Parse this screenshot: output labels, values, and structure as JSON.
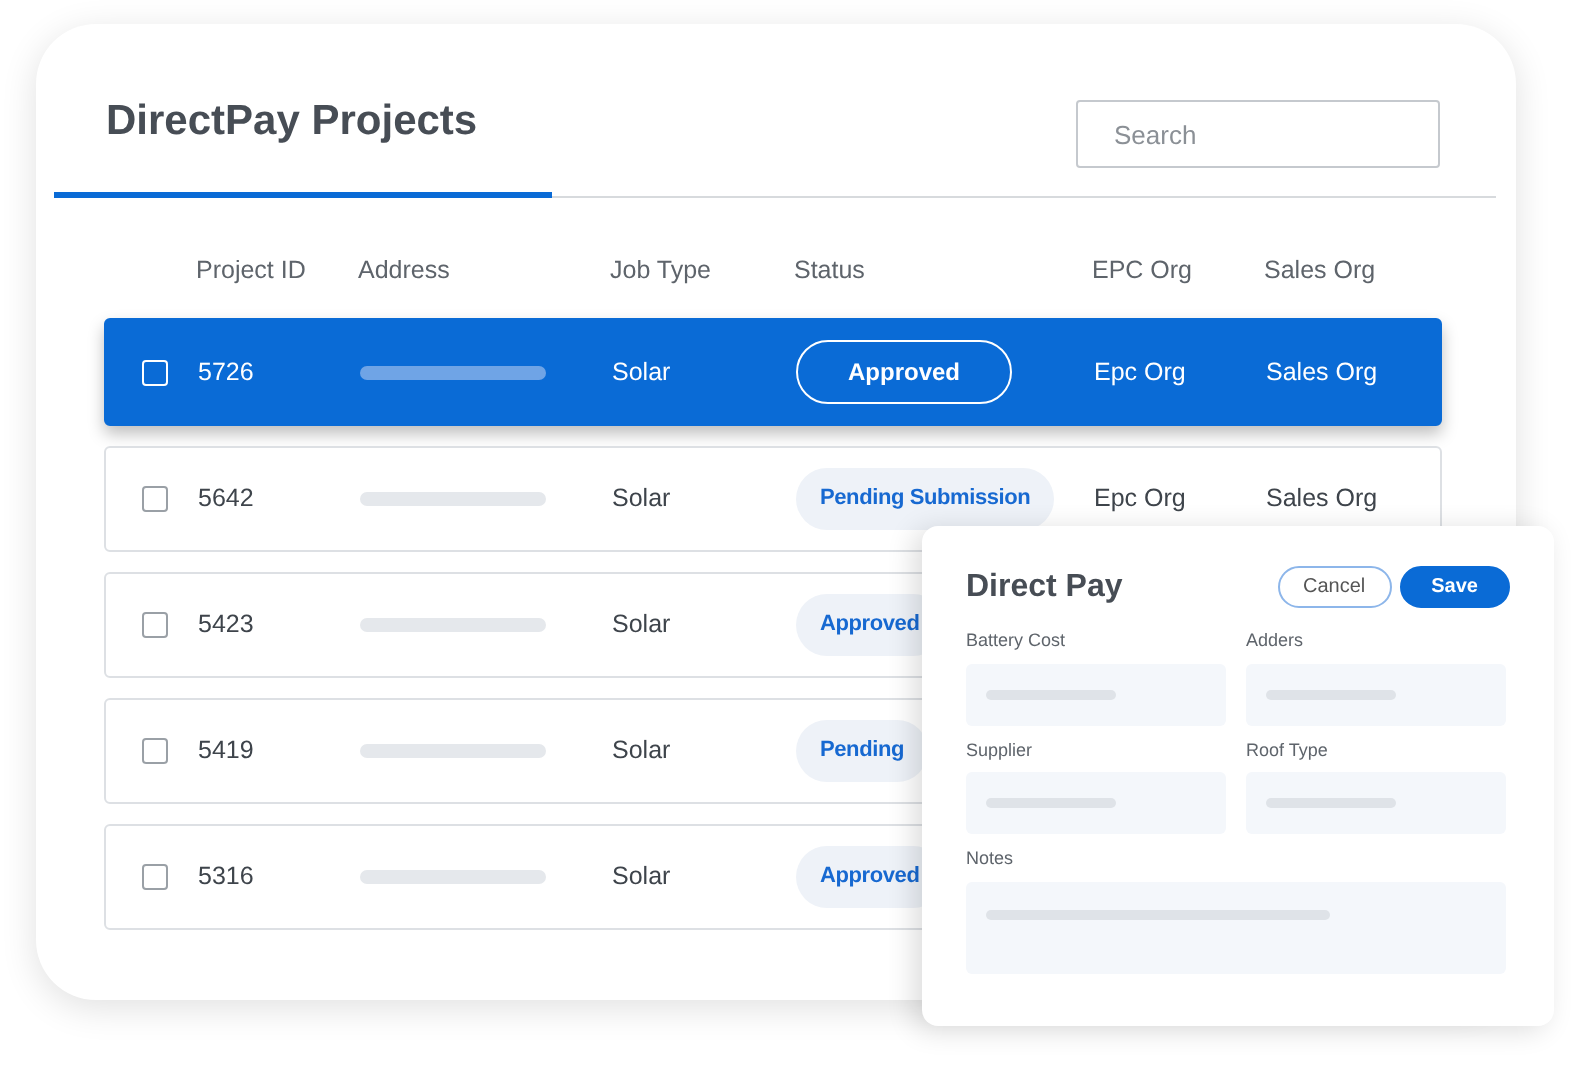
{
  "title": "DirectPay Projects",
  "search": {
    "placeholder": "Search"
  },
  "table": {
    "columns": [
      "Project ID",
      "Address",
      "Job Type",
      "Status",
      "EPC Org",
      "Sales Org"
    ],
    "rows": [
      {
        "selected": true,
        "checked": false,
        "project_id": "5726",
        "job_type": "Solar",
        "status": "Approved",
        "epc_org": "Epc Org",
        "sales_org": "Sales Org"
      },
      {
        "selected": false,
        "checked": false,
        "project_id": "5642",
        "job_type": "Solar",
        "status": "Pending Submission",
        "epc_org": "Epc Org",
        "sales_org": "Sales Org"
      },
      {
        "selected": false,
        "checked": false,
        "project_id": "5423",
        "job_type": "Solar",
        "status": "Approved"
      },
      {
        "selected": false,
        "checked": false,
        "project_id": "5419",
        "job_type": "Solar",
        "status": "Pending"
      },
      {
        "selected": false,
        "checked": false,
        "project_id": "5316",
        "job_type": "Solar",
        "status": "Approved"
      }
    ]
  },
  "panel": {
    "title": "Direct Pay",
    "buttons": [
      {
        "label": "Cancel",
        "kind": "secondary"
      },
      {
        "label": "Save",
        "kind": "primary"
      }
    ],
    "fields": [
      {
        "label": "Battery Cost",
        "kind": "short"
      },
      {
        "label": "Adders",
        "kind": "short"
      },
      {
        "label": "Supplier",
        "kind": "short"
      },
      {
        "label": "Roof Type",
        "kind": "short"
      },
      {
        "label": "Notes",
        "kind": "wide"
      }
    ]
  }
}
